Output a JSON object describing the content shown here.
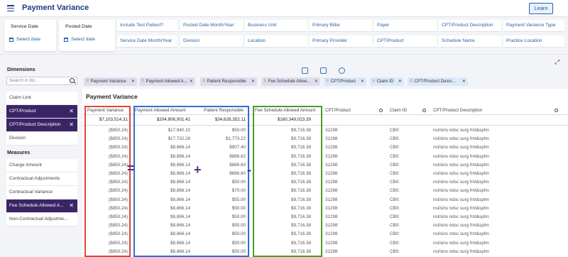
{
  "header": {
    "title": "Payment Variance",
    "learn_label": "Learn"
  },
  "filters": {
    "service_date": {
      "label": "Service Date",
      "select": "Select date"
    },
    "posted_date": {
      "label": "Posted Date",
      "select": "Select date"
    },
    "chips": [
      "Include Test Patient?",
      "Posted Date Month/Year",
      "Business Unit",
      "Primary Biller",
      "Payer",
      "CPT/Product Description",
      "Payment Variance Type",
      "Service Date Month/Year",
      "Division",
      "Location",
      "Primary Provider",
      "CPT/Product",
      "Schedule Name",
      "Practice Location"
    ]
  },
  "dimensions": {
    "title": "Dimensions",
    "search_placeholder": "Search in list...",
    "items": [
      {
        "label": "Claim Link",
        "selected": false
      },
      {
        "label": "CPT/Product",
        "selected": true
      },
      {
        "label": "CPT/Product Description",
        "selected": true
      },
      {
        "label": "Division",
        "selected": false
      }
    ]
  },
  "measures": {
    "title": "Measures",
    "items": [
      {
        "label": "Charge Amount",
        "selected": false
      },
      {
        "label": "Contractual Adjustments",
        "selected": false
      },
      {
        "label": "Contractual Variance",
        "selected": false
      },
      {
        "label": "Fee Schedule Allowed A...",
        "selected": true
      },
      {
        "label": "Non-Contractual Adjustme...",
        "selected": false
      }
    ]
  },
  "pills": [
    {
      "label": "Payment Variance",
      "color": "purple"
    },
    {
      "label": "Payment Allowed A...",
      "color": "purple"
    },
    {
      "label": "Patient Responsible",
      "color": "purple"
    },
    {
      "label": "Fee Schedule Allow...",
      "color": "purple"
    },
    {
      "label": "CPT/Product",
      "color": "blue"
    },
    {
      "label": "Claim ID",
      "color": "blue"
    },
    {
      "label": "CPT/Product Descr...",
      "color": "blue"
    }
  ],
  "table": {
    "title": "Payment Variance",
    "columns": [
      "Payment Variance",
      "Payment Allowed Amount",
      "Patient Responsible",
      "Fee Schedule Allowed Amount",
      "CPT/Product",
      "Claim ID",
      "CPT/Product Description"
    ],
    "totals": [
      "$7,103,514.31",
      "$204,806,001.41",
      "$34,626,352.11",
      "$160,349,023.39",
      "",
      "",
      ""
    ],
    "rows": [
      [
        "($850.24)",
        "$17,940.10",
        "$50.00",
        "$9,716.38",
        "31298",
        "CB0:",
        "nsl/sins ndsc surg frnt&sphn"
      ],
      [
        "($850.24)",
        "$17,732.28",
        "$1,773.22",
        "$9,716.38",
        "31298",
        "CB0:",
        "nsl/sins ndsc surg frnt&sphn"
      ],
      [
        "($850.24)",
        "$8,866.14",
        "$907.40",
        "$9,716.38",
        "31298",
        "CB0:",
        "nsl/sins ndsc surg frnt&sphn"
      ],
      [
        "($850.24)",
        "$8,866.14",
        "$886.62",
        "$9,716.38",
        "31298",
        "CB0:",
        "nsl/sins ndsc surg frnt&sphn"
      ],
      [
        "($850.24)",
        "$8,866.14",
        "$886.60",
        "$9,716.38",
        "31298",
        "CB0:",
        "nsl/sins ndsc surg frnt&sphn"
      ],
      [
        "($850.24)",
        "$8,866.14",
        "$886.60",
        "$9,716.38",
        "31298",
        "CB0:",
        "nsl/sins ndsc surg frnt&sphn"
      ],
      [
        "($850.24)",
        "$8,866.14",
        "$50.00",
        "$9,716.38",
        "31298",
        "CB0:",
        "nsl/sins ndsc surg frnt&sphn"
      ],
      [
        "($850.24)",
        "$8,866.14",
        "$70.00",
        "$9,716.38",
        "31298",
        "CB0:",
        "nsl/sins ndsc surg frnt&sphn"
      ],
      [
        "($850.24)",
        "$8,866.14",
        "$55.00",
        "$9,716.38",
        "31298",
        "CB0:",
        "nsl/sins ndsc surg frnt&sphn"
      ],
      [
        "($850.24)",
        "$8,866.14",
        "$50.00",
        "$9,716.38",
        "31298",
        "CB0:",
        "nsl/sins ndsc surg frnt&sphn"
      ],
      [
        "($850.24)",
        "$8,866.14",
        "$50.00",
        "$9,716.38",
        "31298",
        "CB0:",
        "nsl/sins ndsc surg frnt&sphn"
      ],
      [
        "($850.24)",
        "$8,866.14",
        "$50.00",
        "$9,716.38",
        "31298",
        "CB0:",
        "nsl/sins ndsc surg frnt&sphn"
      ],
      [
        "($850.24)",
        "$8,866.14",
        "$50.00",
        "$9,716.38",
        "31298",
        "CB0:",
        "nsl/sins ndsc surg frnt&sphn"
      ],
      [
        "($850.24)",
        "$8,866.14",
        "$50.00",
        "$9,716.38",
        "31298",
        "CB0:",
        "nsl/sins ndsc surg frnt&sphn"
      ],
      [
        "($850.24)",
        "$8,866.14",
        "$50.00",
        "$9,716.38",
        "31298",
        "CB0:",
        "nsl/sins ndsc surg frnt&sphn"
      ]
    ]
  },
  "annotations": {
    "operators": [
      "=",
      "+",
      "-"
    ],
    "colors": {
      "red": "#e0463a",
      "blue": "#2f6fd6",
      "green": "#4c9a2a",
      "operator": "#5a2d82"
    }
  },
  "colors": {
    "accent": "#1e3a8a",
    "link": "#2563a8",
    "selected": "#3a2466"
  }
}
